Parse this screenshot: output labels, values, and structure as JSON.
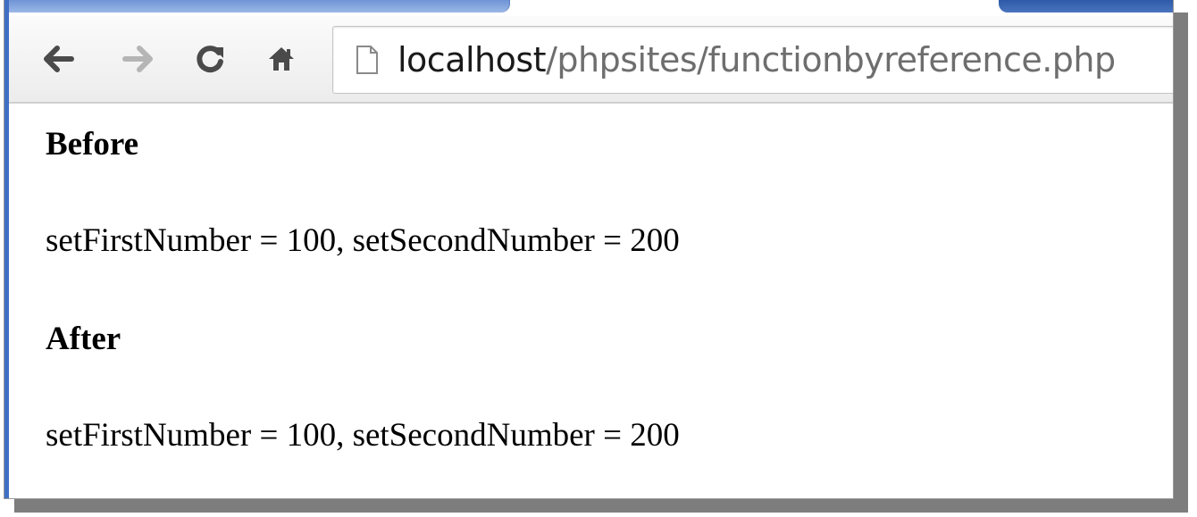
{
  "browser": {
    "toolbar": {
      "back_icon": "arrow-left-icon",
      "forward_icon": "arrow-right-icon",
      "reload_icon": "reload-icon",
      "home_icon": "home-icon"
    },
    "address_bar": {
      "page_icon": "page-icon",
      "host": "localhost",
      "path": "/phpsites/functionbyreference.php"
    }
  },
  "page": {
    "before_heading": "Before",
    "before_text": "setFirstNumber = 100, setSecondNumber = 200",
    "after_heading": "After",
    "after_text": "setFirstNumber = 100, setSecondNumber = 200"
  },
  "colors": {
    "accent": "#3f6fc4",
    "url_host": "#1a1a1a",
    "url_path": "#6e6e6e",
    "forward_disabled": "#b5b5b5"
  }
}
